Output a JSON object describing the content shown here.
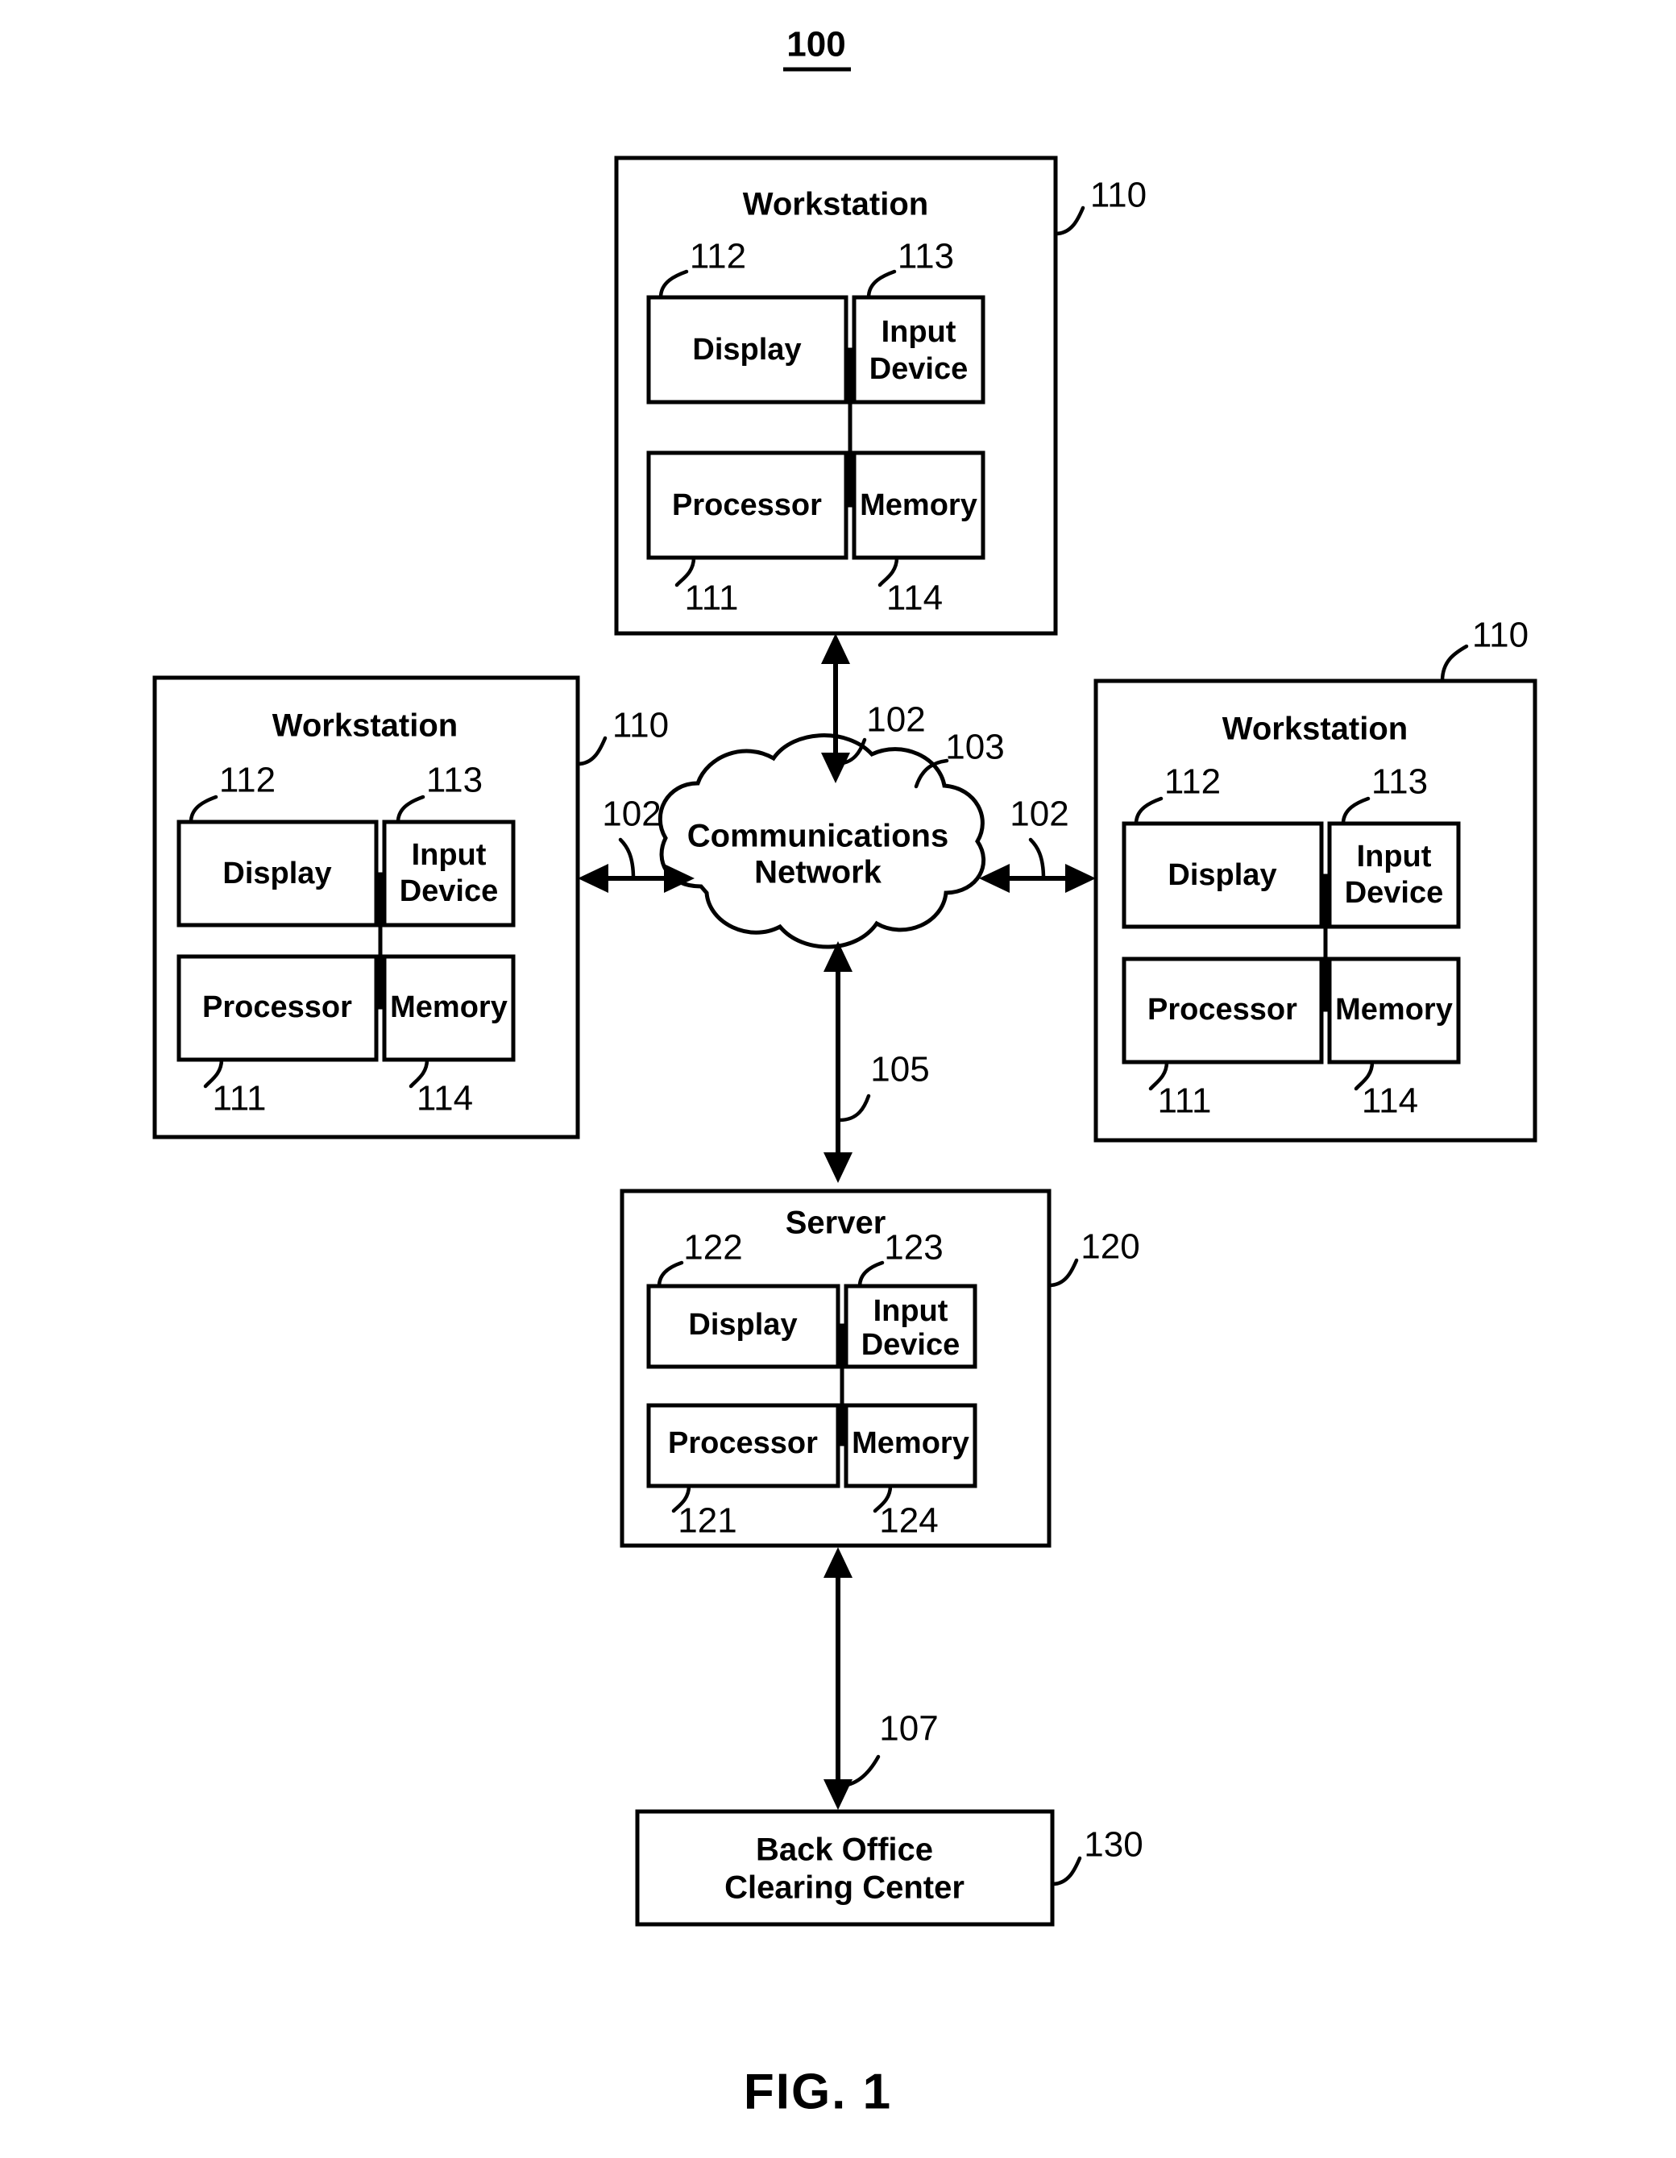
{
  "figure": {
    "system_number": "100",
    "caption": "FIG. 1"
  },
  "nodes": {
    "workstation_top": {
      "title": "Workstation",
      "ref": "110",
      "parts": [
        {
          "label": "Display",
          "ref": "112"
        },
        {
          "label": "Input\nDevice",
          "ref": "113",
          "line1": "Input",
          "line2": "Device"
        },
        {
          "label": "Processor",
          "ref": "111"
        },
        {
          "label": "Memory",
          "ref": "114"
        }
      ]
    },
    "workstation_left": {
      "title": "Workstation",
      "ref": "110",
      "parts": [
        {
          "label": "Display",
          "ref": "112"
        },
        {
          "label": "Input\nDevice",
          "ref": "113",
          "line1": "Input",
          "line2": "Device"
        },
        {
          "label": "Processor",
          "ref": "111"
        },
        {
          "label": "Memory",
          "ref": "114"
        }
      ]
    },
    "workstation_right": {
      "title": "Workstation",
      "ref": "110",
      "parts": [
        {
          "label": "Display",
          "ref": "112"
        },
        {
          "label": "Input\nDevice",
          "ref": "113",
          "line1": "Input",
          "line2": "Device"
        },
        {
          "label": "Processor",
          "ref": "111"
        },
        {
          "label": "Memory",
          "ref": "114"
        }
      ]
    },
    "server": {
      "title": "Server",
      "ref": "120",
      "parts": [
        {
          "label": "Display",
          "ref": "122"
        },
        {
          "label": "Input\nDevice",
          "ref": "123",
          "line1": "Input",
          "line2": "Device"
        },
        {
          "label": "Processor",
          "ref": "121"
        },
        {
          "label": "Memory",
          "ref": "124"
        }
      ]
    },
    "network": {
      "line1": "Communications",
      "line2": "Network",
      "ref": "103"
    },
    "back_office": {
      "line1": "Back Office",
      "line2": "Clearing Center",
      "ref": "130"
    }
  },
  "links": [
    {
      "id": "link-top",
      "ref": "102",
      "from": "workstation_top",
      "to": "network"
    },
    {
      "id": "link-left",
      "ref": "102",
      "from": "workstation_left",
      "to": "network"
    },
    {
      "id": "link-right",
      "ref": "102",
      "from": "workstation_right",
      "to": "network"
    },
    {
      "id": "link-server",
      "ref": "105",
      "from": "network",
      "to": "server"
    },
    {
      "id": "link-backoffice",
      "ref": "107",
      "from": "server",
      "to": "back_office"
    }
  ]
}
